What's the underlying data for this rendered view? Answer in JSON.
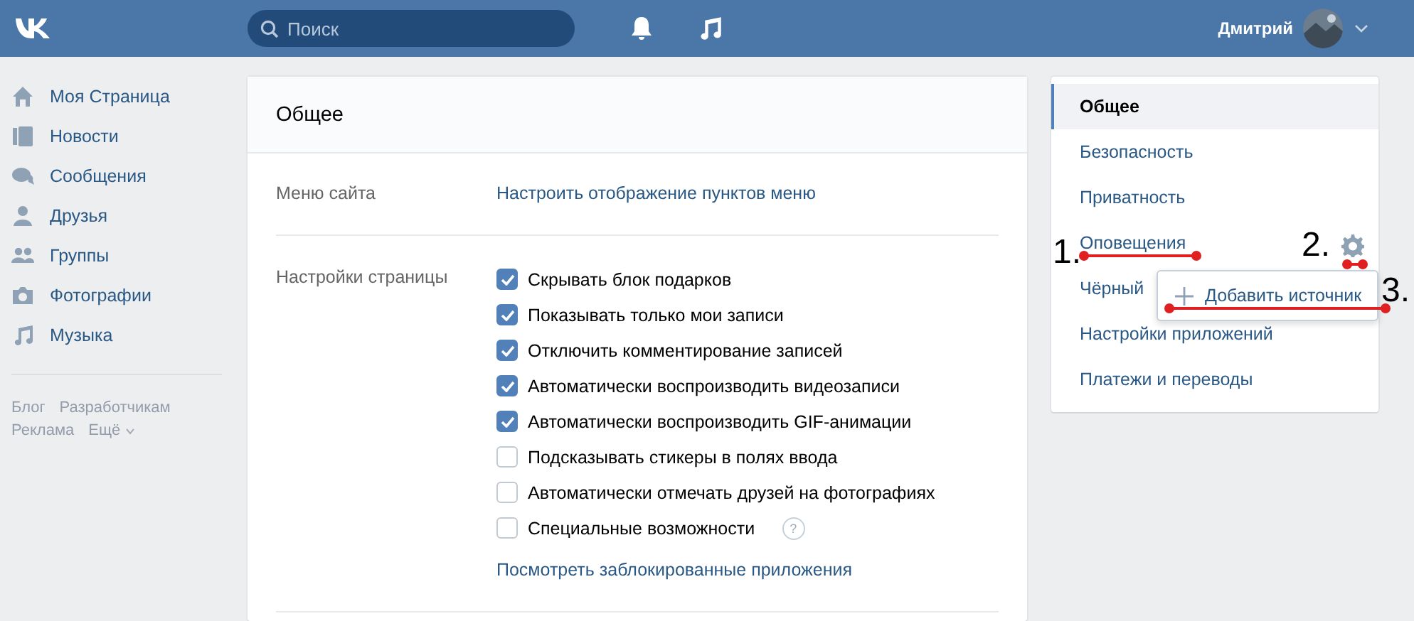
{
  "header": {
    "search": {
      "placeholder": "Поиск"
    },
    "user_name": "Дмитрий"
  },
  "sidebar": {
    "items": [
      {
        "label": "Моя Страница"
      },
      {
        "label": "Новости"
      },
      {
        "label": "Сообщения"
      },
      {
        "label": "Друзья"
      },
      {
        "label": "Группы"
      },
      {
        "label": "Фотографии"
      },
      {
        "label": "Музыка"
      }
    ],
    "footer_links": [
      "Блог",
      "Разработчикам",
      "Реклама",
      "Ещё"
    ]
  },
  "settings": {
    "title": "Общее",
    "rows": [
      {
        "label": "Меню сайта",
        "link": "Настроить отображение пунктов меню"
      },
      {
        "label": "Настройки страницы",
        "options": [
          {
            "label": "Скрывать блок подарков",
            "checked": true
          },
          {
            "label": "Показывать только мои записи",
            "checked": true
          },
          {
            "label": "Отключить комментирование записей",
            "checked": true
          },
          {
            "label": "Автоматически воспроизводить видеозаписи",
            "checked": true
          },
          {
            "label": "Автоматически воспроизводить GIF-анимации",
            "checked": true
          },
          {
            "label": "Подсказывать стикеры в полях ввода",
            "checked": false
          },
          {
            "label": "Автоматически отмечать друзей на фотографиях",
            "checked": false
          },
          {
            "label": "Специальные возможности",
            "checked": false,
            "help": "?"
          }
        ],
        "link": "Посмотреть заблокированные приложения"
      }
    ]
  },
  "menu": {
    "items": [
      {
        "label": "Общее",
        "selected": true
      },
      {
        "label": "Безопасность",
        "selected": false
      },
      {
        "label": "Приватность",
        "selected": false
      },
      {
        "label": "Оповещения",
        "selected": false
      },
      {
        "label": "Чёрный",
        "selected": false
      },
      {
        "label": "Настройки приложений",
        "selected": false
      },
      {
        "label": "Платежи и переводы",
        "selected": false
      }
    ]
  },
  "popup": {
    "label": "Добавить источник"
  },
  "annotations": [
    {
      "label": "1."
    },
    {
      "label": "2."
    },
    {
      "label": "3."
    }
  ]
}
